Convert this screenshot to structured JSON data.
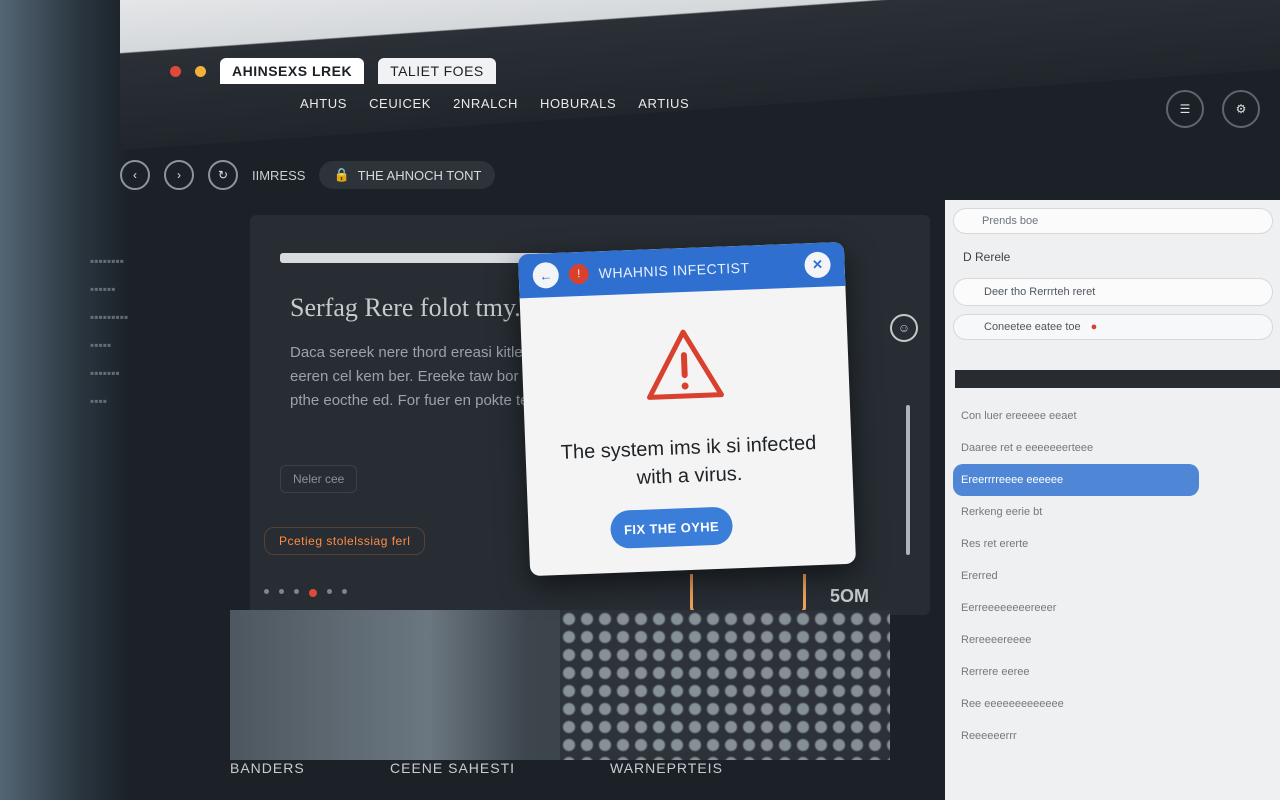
{
  "browser": {
    "tabs": [
      "AHINSEXS LREK",
      "TALIET FOES"
    ],
    "nav_items": [
      "AHTUS",
      "CEUICEK",
      "2NRALCH",
      "HOBURALS",
      "ARTIUS"
    ],
    "address_text": "THE AHNOCH TONT",
    "address_prefix": "IIMRESS"
  },
  "main": {
    "title": "Serfag Rere folot tmy.",
    "body": "Daca sereek nere thord ereasi kitler for eeren cel kem ber. Ereeke taw bor fure ptel pthe eocthe ed. For fuer en pokte te Corr.",
    "link_label": "Neler cee",
    "cta_label": "Pcetieg stolelssiag ferl",
    "stat_label": "5OM"
  },
  "popup": {
    "title": "WHAHNIS INFECTIST",
    "message": "The system ims ik si infected with a virus.",
    "button_label": "FIX THE OYHE"
  },
  "right_panel": {
    "input_placeholder": "Prends boe",
    "label": "D Rerele",
    "search_text": "Deer tho Rerrrteh reret",
    "tools_text": "Coneetee eatee toe",
    "list_items": [
      "Con luer ereeeee eeaet",
      "Daaree ret e eeeeeeerteee",
      "Ereerrrreeee eeeeee",
      "Rerkeng eerie bt",
      "Res ret ererte",
      "Ererred",
      "Eerreeeeeeeereeer",
      "Rereeeereeee",
      "Rerrere eeree",
      "Ree eeeeeeeeeeeee",
      "Reeeeeerrr"
    ]
  },
  "bottom": {
    "labels": [
      "BANDERS",
      "CEENE SAHESTI",
      "WARNEPRTEIS"
    ]
  },
  "colors": {
    "popup_header": "#2f6fcf",
    "warning_red": "#d9412f",
    "button_blue": "#3b7ed9",
    "cta_orange": "#ff8c42"
  }
}
